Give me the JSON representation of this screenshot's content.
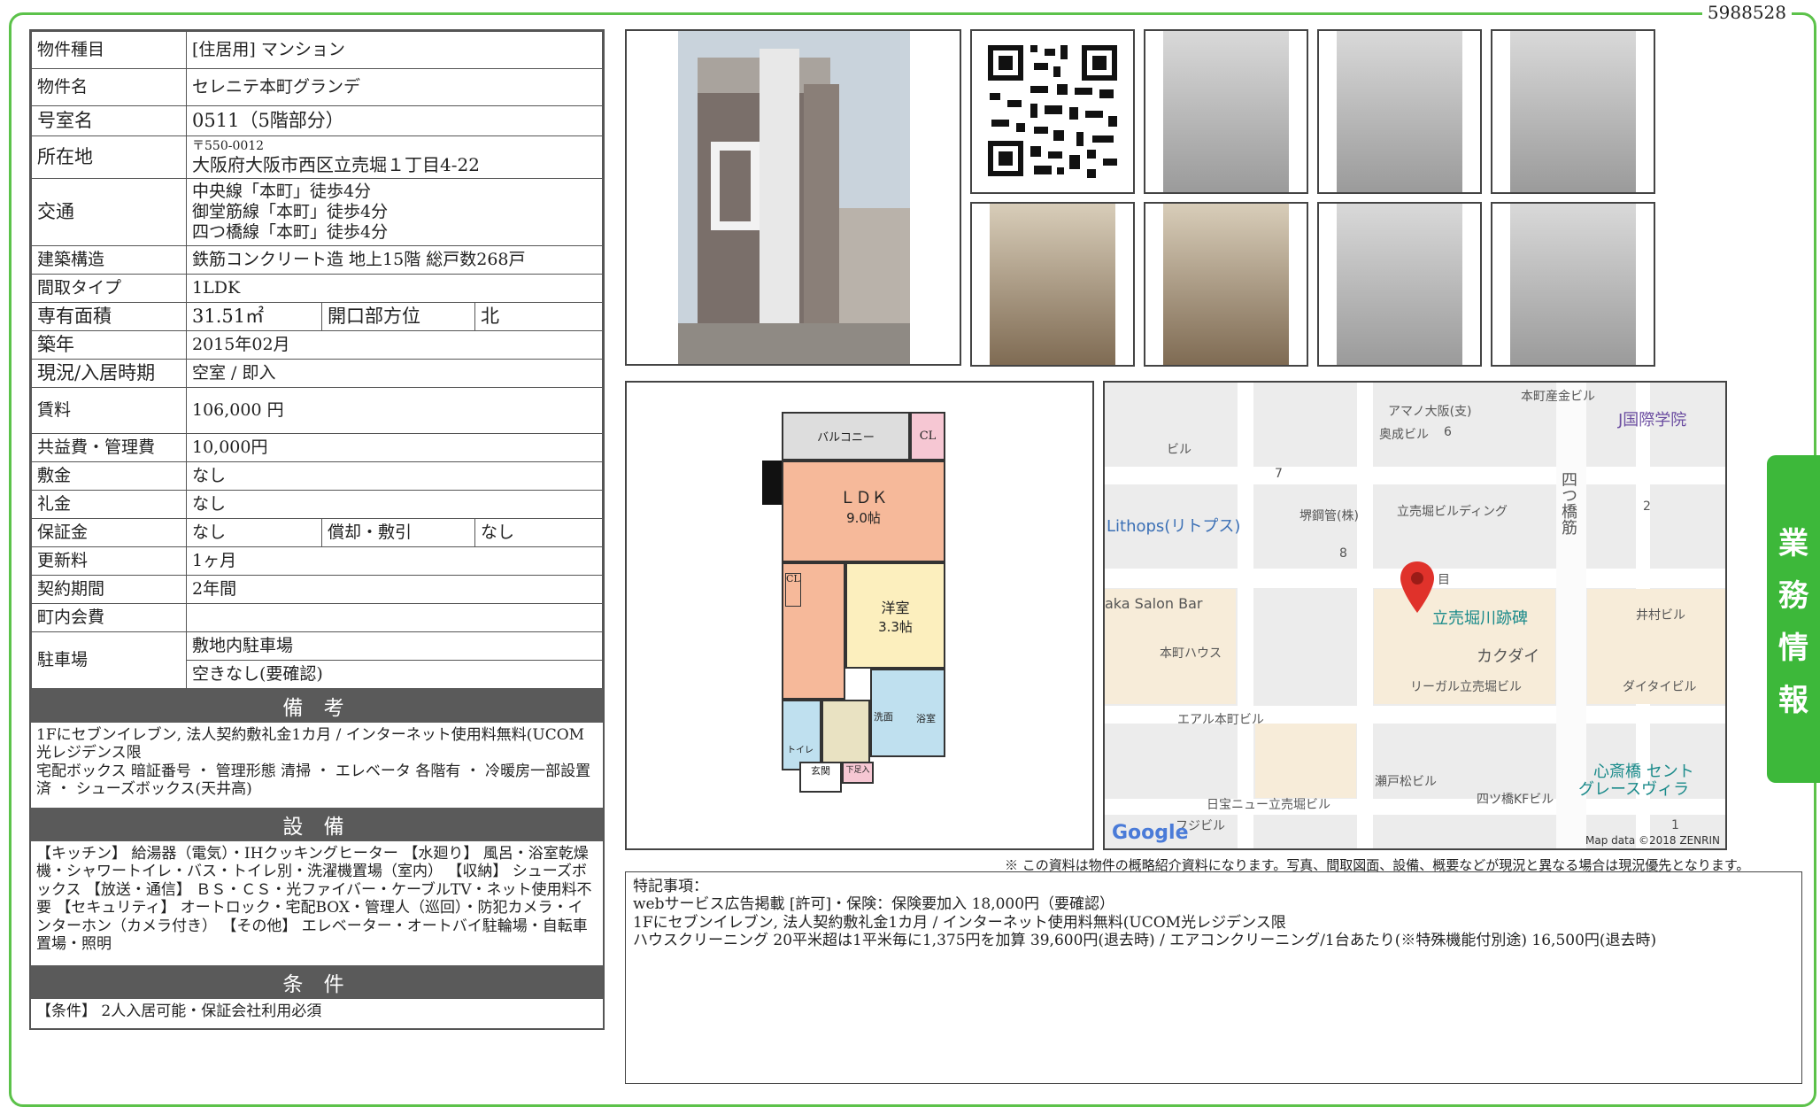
{
  "doc_id": "5988528",
  "side_tab": [
    "業",
    "務",
    "情",
    "報"
  ],
  "info": {
    "kind_label": "物件種目",
    "kind_value": "[住居用] マンション",
    "name_label": "物件名",
    "name_value": "セレニテ本町グランデ",
    "room_label": "号室名",
    "room_value": "0511（5階部分）",
    "addr_label": "所在地",
    "addr_zip": "〒550-0012",
    "addr_value": "大阪府大阪市西区立売堀１丁目4-22",
    "transit_label": "交通",
    "transit": [
      "中央線「本町」徒歩4分",
      "御堂筋線「本町」徒歩4分",
      "四つ橋線「本町」徒歩4分"
    ],
    "struct_label": "建築構造",
    "struct_value": "鉄筋コンクリート造 地上15階 総戸数268戸",
    "layout_label": "間取タイプ",
    "layout_value": "1LDK",
    "area_label": "専有面積",
    "area_value": "31.51㎡",
    "dir_label": "開口部方位",
    "dir_value": "北",
    "built_label": "築年",
    "built_value": "2015年02月",
    "status_label": "現況/入居時期",
    "status_value": "空室 / 即入",
    "rent_label": "賃料",
    "rent_value": "106,000 円",
    "fee_label": "共益費・管理費",
    "fee_value": "10,000円",
    "deposit_label": "敷金",
    "deposit_value": "なし",
    "key_label": "礼金",
    "key_value": "なし",
    "guarantee_label": "保証金",
    "guarantee_value": "なし",
    "amort_label": "償却・敷引",
    "amort_value": "なし",
    "renew_label": "更新料",
    "renew_value": "1ヶ月",
    "term_label": "契約期間",
    "term_value": "2年間",
    "town_label": "町内会費",
    "town_value": "",
    "parking_label": "駐車場",
    "parking_value1": "敷地内駐車場",
    "parking_value2": "空きなし(要確認)"
  },
  "remarks": {
    "title": "備 考",
    "text": "1Fにセブンイレブン, 法人契約敷礼金1カ月 / インターネット使用料無料(UCOM光レジデンス限\n宅配ボックス 暗証番号 ・ 管理形態 清掃 ・ エレベータ 各階有 ・ 冷暖房一部設置済 ・ シューズボックス(天井高)"
  },
  "equipment": {
    "title": "設 備",
    "text": "【キッチン】 給湯器（電気）・IHクッキングヒーター 【水廻り】 風呂・浴室乾燥機・シャワートイレ・バス・トイレ別・洗濯機置場（室内） 【収納】 シューズボックス 【放送・通信】 ＢＳ・ＣＳ・光ファイバー・ケーブルTV・ネット使用料不要 【セキュリティ】 オートロック・宅配BOX・管理人（巡回）・防犯カメラ・インターホン（カメラ付き） 【その他】 エレベーター・オートバイ駐輪場・自転車置場・照明"
  },
  "conditions": {
    "title": "条 件",
    "text": "【条件】 2人入居可能・保証会社利用必須"
  },
  "floorplan": {
    "balcony": "バルコニー",
    "cl1": "CL",
    "ldk": "ＬＤＫ",
    "ldk_size": "9.0帖",
    "western": "洋室",
    "western_size": "3.3帖",
    "cl2": "CL",
    "wash": "洗面",
    "bath": "浴室",
    "toilet": "トイレ",
    "entrance": "玄関",
    "shoe": "下足入"
  },
  "map": {
    "labels": [
      "本町産金ビル",
      "アマノ大阪(支)",
      "奥成ビル",
      "6",
      "ビル",
      "7",
      "J国際学院",
      "堺鋼管(株)",
      "立売堀ビルディング",
      "2",
      "四つ橋筋",
      "Lithops(リトプス)",
      "8",
      "目",
      "立売堀川跡碑",
      "aka Salon Bar",
      "本町ハウス",
      "カクダイ",
      "リーガル立売堀ビル",
      "井村ビル",
      "ダイタイビル",
      "エアル本町ビル",
      "瀬戸松ビル",
      "四ツ橋KFビル",
      "心斎橋 セント",
      "グレースヴィラ",
      "1",
      "日宝ニュー立売堀ビル",
      "フジビル"
    ],
    "google": "Google",
    "attribution": "Map data ©2018 ZENRIN"
  },
  "disclaimer": "※ この資料は物件の概略紹介資料になります。写真、間取図面、設備、概要などが現況と異なる場合は現況優先となります。",
  "tokki": {
    "title": "特記事項：",
    "lines": [
      "webサービス広告掲載 [許可]・保険：保険要加入 18,000円（要確認）",
      "1Fにセブンイレブン, 法人契約敷礼金1カ月 / インターネット使用料無料(UCOM光レジデンス限",
      "ハウスクリーニング 20平米超は1平米毎に1,375円を加算 39,600円(退去時) / エアコンクリーニング/1台あたり(※特殊機能付別途) 16,500円(退去時)"
    ]
  }
}
